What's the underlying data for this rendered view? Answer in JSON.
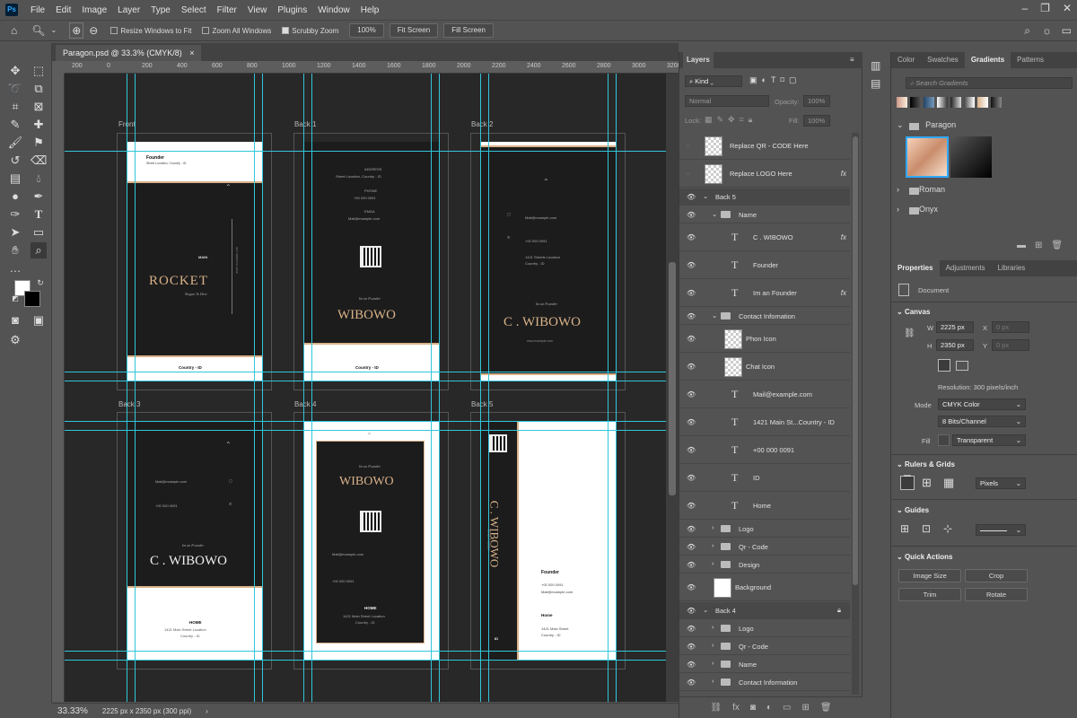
{
  "menu": {
    "logo": "Ps",
    "items": [
      "File",
      "Edit",
      "Image",
      "Layer",
      "Type",
      "Select",
      "Filter",
      "View",
      "Plugins",
      "Window",
      "Help"
    ]
  },
  "options": {
    "resize_windows": "Resize Windows to Fit",
    "zoom_all": "Zoom All Windows",
    "scrubby": "Scrubby Zoom",
    "zoom_pct": "100%",
    "fit_screen": "Fit Screen",
    "fill_screen": "Fill Screen"
  },
  "document": {
    "tab": "Paragon.psd @ 33.3% (CMYK/8)",
    "close": "×"
  },
  "ruler_h": [
    "200",
    "0",
    "200",
    "400",
    "600",
    "800",
    "1000",
    "1200",
    "1400",
    "1600",
    "1800",
    "2000",
    "2200",
    "2400",
    "2600",
    "2800",
    "3000",
    "3200"
  ],
  "artboards": {
    "front": {
      "label": "Front",
      "founder": "Founder",
      "location": "Street Location, Country - ID",
      "main": "MAIN",
      "title": "ROCKET",
      "tagline": "Slogan To Here",
      "vertical": "GET WEBSITE HERE",
      "footer": "Country - ID"
    },
    "back1": {
      "label": "Back 1",
      "phone_label": "PHONE",
      "email_label": "EMAIL",
      "address_label": "ADDRESS",
      "location": "Street Location, Country - ID",
      "phone": "+00 000 0091",
      "email": "Mail@example.com",
      "subtitle": "Im an Founder",
      "name": "WIBOWO",
      "footer": "Country - ID"
    },
    "back2": {
      "label": "Back 2",
      "email": "Mail@example.com",
      "phone": "+00 000 0091",
      "location": "1421 Streets Location",
      "country": "Country - ID",
      "subtitle": "Im an Founder",
      "name": "C . WIBOWO",
      "web": "www.example.com"
    },
    "back3": {
      "label": "Back 3",
      "email": "Mail@example.com",
      "phone": "+00 000 0091",
      "subtitle": "Im an Founder",
      "name": "C . WIBOWO",
      "home": "HOME",
      "location": "1421 Main Street Location",
      "country": "Country - ID"
    },
    "back4": {
      "label": "Back 4",
      "subtitle": "Im an Founder",
      "name": "WIBOWO",
      "email": "Mail@example.com",
      "phone": "+00 000 0091",
      "home": "HOME",
      "location": "1421 Main Street Location",
      "country": "Country - ID"
    },
    "back5": {
      "label": "Back 5",
      "subtitle": "Im an Founder",
      "name": "C . WIBOWO",
      "founder": "Founder",
      "phone": "+00 000 0091",
      "email": "Mail@example.com",
      "home": "Home",
      "location": "1421 Main Street",
      "country": "Country - ID",
      "id": "ID"
    }
  },
  "status": {
    "zoom": "33.33%",
    "doc_size": "2225 px x 2350 px (300 ppi)"
  },
  "layers": {
    "tab": "Layers",
    "filter": "Kind",
    "blend": "Normal",
    "opacity_label": "Opacity:",
    "opacity": "100%",
    "lock_label": "Lock:",
    "fill_label": "Fill:",
    "fill": "100%",
    "rows": [
      "Replace QR - CODE Here",
      "Replace LOGO Here",
      "Back 5",
      "Name",
      "C . WIBOWO",
      "Founder",
      "Im an Founder",
      "Contact Infomation",
      "Phon Icon",
      "Chat Icon",
      "Mail@example.com",
      "1421 Main St...Country - ID",
      "+00 000 0091",
      "ID",
      "Home",
      "Logo",
      "Qr - Code",
      "Design",
      "Background",
      "Back 4",
      "Logo",
      "Qr - Code",
      "Name",
      "Contact Information"
    ]
  },
  "gradients": {
    "tabs": [
      "Color",
      "Swatches",
      "Gradients",
      "Patterns"
    ],
    "search": "Search Gradients",
    "folders": [
      "Paragon",
      "Roman",
      "Onyx"
    ]
  },
  "properties": {
    "tabs": [
      "Properties",
      "Adjustments",
      "Libraries"
    ],
    "doc_label": "Document",
    "canvas": "Canvas",
    "w_label": "W",
    "w": "2225 px",
    "h_label": "H",
    "h": "2350 px",
    "x_label": "X",
    "x": "0 px",
    "y_label": "Y",
    "y": "0 px",
    "resolution": "Resolution: 300 pixels/inch",
    "mode_label": "Mode",
    "mode": "CMYK Color",
    "bits": "8 Bits/Channel",
    "fill_label": "Fill",
    "fill": "Transparent",
    "rulers_grids": "Rulers & Grids",
    "units": "Pixels",
    "guides": "Guides",
    "quick_actions": "Quick Actions",
    "image_size": "Image Size",
    "crop": "Crop",
    "trim": "Trim",
    "rotate": "Rotate"
  },
  "colors": {
    "accent": "#d9b28a",
    "guide": "#31c6d9",
    "bg": "#535353"
  }
}
